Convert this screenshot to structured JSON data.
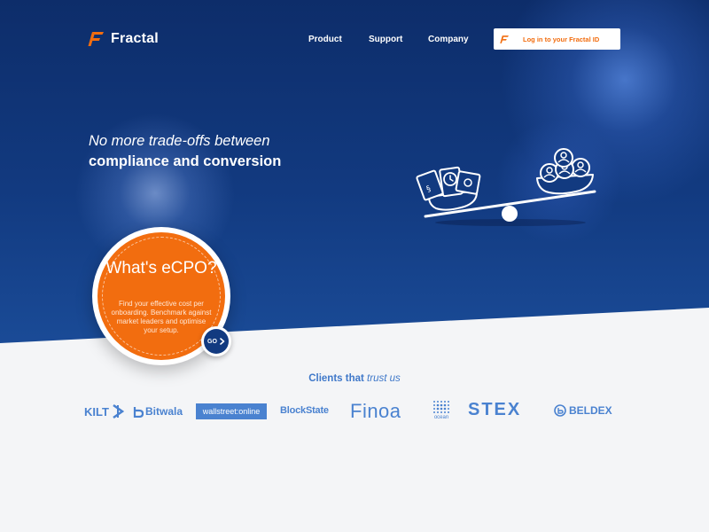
{
  "header": {
    "brand": "Fractal",
    "nav": [
      "Product",
      "Support",
      "Company"
    ],
    "login_label": "Log in to your Fractal ID"
  },
  "hero": {
    "headline_line1": "No more trade-offs between",
    "headline_line2": "compliance and conversion"
  },
  "ecpo": {
    "title": "What's eCPO?",
    "description": "Find your effective cost per onboarding. Benchmark against market leaders and optimise your setup.",
    "go_label": "GO"
  },
  "clients": {
    "title_bold": "Clients that",
    "title_italic": "trust us",
    "logos": [
      "KILT",
      "Bitwala",
      "wallstreet:online",
      "BlockState",
      "Finoa",
      "ocean",
      "STEX",
      "BELDEX"
    ]
  },
  "colors": {
    "brand_orange": "#f26d0f",
    "hero_blue": "#123a80",
    "client_blue": "#4a82d0"
  },
  "icons": [
    "fractal-logo-icon",
    "scale-illustration",
    "chevron-right-icon"
  ]
}
